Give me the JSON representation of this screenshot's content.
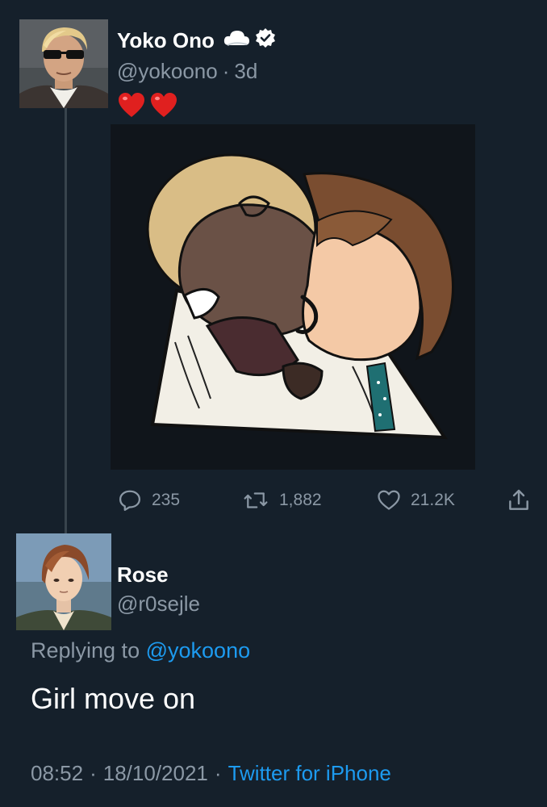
{
  "tweet": {
    "author": {
      "name": "Yoko Ono",
      "handle": "@yokoono",
      "age": "3d",
      "separator": "·",
      "avatar_icon": "avatar-blonde-sunglasses"
    },
    "text": "❤️❤️",
    "hearts": [
      "❤",
      "❤"
    ],
    "media_description_icon": "illustration",
    "actions": {
      "reply": {
        "icon": "reply-icon",
        "count": "235"
      },
      "retweet": {
        "icon": "retweet-icon",
        "count": "1,882"
      },
      "like": {
        "icon": "heart-icon",
        "count": "21.2K"
      },
      "share": {
        "icon": "share-icon"
      }
    }
  },
  "reply": {
    "author": {
      "name": "Rose",
      "handle": "@r0sejle",
      "avatar_icon": "avatar-brown-hair"
    },
    "replying_prefix": "Replying to",
    "replying_to": "@yokoono",
    "text": "Girl move on",
    "time": "08:52",
    "date": "18/10/2021",
    "separator": "·",
    "client": "Twitter for iPhone"
  },
  "colors": {
    "background": "#15202b",
    "secondary_text": "#8b98a5",
    "link": "#1d9bf0",
    "heart": "#e0245e"
  }
}
